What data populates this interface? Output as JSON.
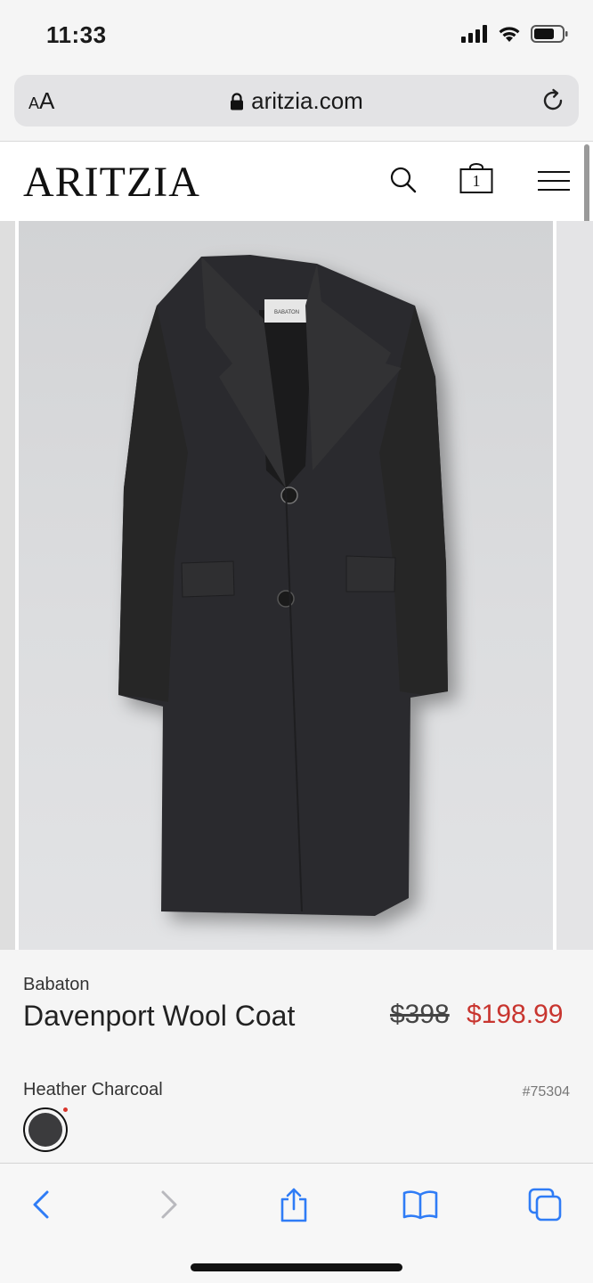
{
  "status_bar": {
    "time": "11:33",
    "icons": [
      "cellular-signal-icon",
      "wifi-icon",
      "battery-icon"
    ]
  },
  "browser": {
    "reader_label_small": "A",
    "reader_label_large": "A",
    "url": "aritzia.com",
    "icons": [
      "lock-icon",
      "reload-icon"
    ]
  },
  "site_header": {
    "logo": "ARITZIA",
    "bag_count": "1",
    "icons": [
      "search-icon",
      "shopping-bag-icon",
      "menu-icon"
    ]
  },
  "product": {
    "brand": "Babaton",
    "name": "Davenport Wool Coat",
    "price_original": "$398",
    "price_sale": "$198.99",
    "color_name": "Heather Charcoal",
    "sku": "#75304",
    "label_tag": "BABATON",
    "swatch_color": "#3b3b3d"
  },
  "colors": {
    "sale_red": "#c8352f",
    "link_blue": "#2f7cf6",
    "coat": "#2c2c2e"
  },
  "toolbar": {
    "icons": [
      "back-icon",
      "forward-icon",
      "share-icon",
      "bookmarks-icon",
      "tabs-icon"
    ]
  }
}
